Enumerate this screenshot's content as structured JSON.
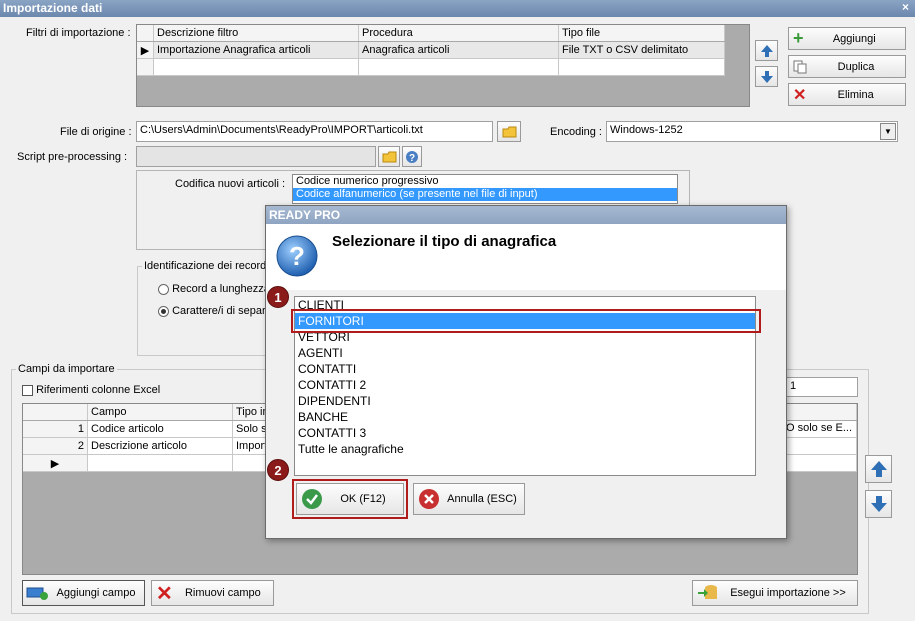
{
  "window": {
    "title": "Importazione dati",
    "close": "×"
  },
  "filters": {
    "label": "Filtri di importazione :",
    "columns": [
      "Descrizione filtro",
      "Procedura",
      "Tipo file"
    ],
    "rows": [
      [
        "Importazione Anagrafica articoli",
        "Anagrafica articoli",
        "File TXT o CSV delimitato"
      ]
    ],
    "buttons": {
      "add": "Aggiungi",
      "duplicate": "Duplica",
      "delete": "Elimina"
    }
  },
  "source": {
    "label": "File di origine :",
    "path": "C:\\Users\\Admin\\Documents\\ReadyPro\\IMPORT\\articoli.txt",
    "encoding_label": "Encoding :",
    "encoding": "Windows-1252",
    "script_label": "Script pre-processing :"
  },
  "coding": {
    "label": "Codifica nuovi articoli :",
    "options": [
      "Codice numerico progressivo",
      "Codice alfanumerico (se presente nel file di input)"
    ]
  },
  "record": {
    "legend": "Identificazione dei record",
    "opt_fixed": "Record a lunghezza",
    "opt_sep": "Carattere/i di separ"
  },
  "fields": {
    "legend": "Campi da importare",
    "excel_refs": "Riferimenti colonne Excel",
    "right_value": "1",
    "columns": [
      "Campo",
      "Tipo im"
    ],
    "rows": [
      {
        "n": "1",
        "campo": "Codice articolo",
        "tipo": "Solo su"
      },
      {
        "n": "2",
        "campo": "Descrizione articolo",
        "tipo": "Import"
      }
    ],
    "right_text": "O solo se E...",
    "buttons": {
      "add_field": "Aggiungi campo",
      "remove_field": "Rimuovi campo",
      "run": "Esegui importazione >>"
    }
  },
  "dialog": {
    "title": "READY PRO",
    "question": "Selezionare il tipo di anagrafica",
    "items": [
      "CLIENTI",
      "FORNITORI",
      "VETTORI",
      "AGENTI",
      "CONTATTI",
      "CONTATTI 2",
      "DIPENDENTI",
      "BANCHE",
      "CONTATTI 3",
      "Tutte le anagrafiche"
    ],
    "selected_index": 1,
    "ok": "OK (F12)",
    "cancel": "Annulla (ESC)"
  },
  "markers": [
    "1",
    "2"
  ],
  "colors": {
    "selection": "#3399ff",
    "marker": "#8b1a1a",
    "highlight": "#b01c1c",
    "title": "#6b87ad"
  }
}
